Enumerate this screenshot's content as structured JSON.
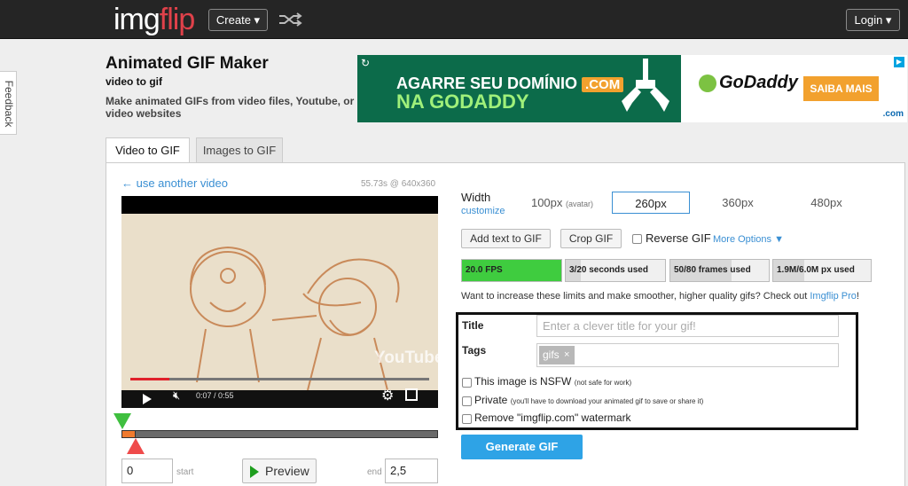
{
  "topbar": {
    "logo_part1": "img",
    "logo_part2": "flip",
    "create_label": "Create ▾",
    "login_label": "Login ▾"
  },
  "feedback": {
    "label": "Feedback"
  },
  "header": {
    "title": "Animated GIF Maker",
    "subtitle": "video to gif",
    "description": "Make animated GIFs from video files, Youtube, or video websites"
  },
  "ad": {
    "line1": "AGARRE SEU DOMÍNIO",
    "dotcom": ".COM",
    "line2": "NA GODADDY",
    "brand": "GoDaddy",
    "cta": "SAIBA MAIS",
    "badge": ".com",
    "adchoice": "▶",
    "refresh_icon": "↻"
  },
  "tabs": [
    {
      "label": "Video to GIF",
      "active": true
    },
    {
      "label": "Images to GIF",
      "active": false
    }
  ],
  "video": {
    "use_another": "← use another video",
    "meta": "55.73s @ 640x360",
    "time": "0:07 / 0:55",
    "watermark": "YouTube",
    "progress_fraction": 0.13
  },
  "timeline": {
    "start_value": "0",
    "start_label": "start",
    "preview_label": "Preview",
    "end_label": "end",
    "end_value": "2,5"
  },
  "width": {
    "label": "Width",
    "customize": "customize",
    "options": [
      {
        "label": "100px",
        "note": "(avatar)"
      },
      {
        "label": "260px",
        "selected": true
      },
      {
        "label": "360px"
      },
      {
        "label": "480px"
      }
    ]
  },
  "actions": {
    "add_text": "Add text to GIF",
    "crop": "Crop GIF",
    "reverse": "Reverse GIF",
    "more_options": "More Options ▼"
  },
  "meters": [
    {
      "text": "20.0 FPS",
      "fraction": 1.0,
      "color": "#3fcc3f"
    },
    {
      "text": "3/20 seconds used",
      "fraction": 0.15,
      "color": "#d8d8d8"
    },
    {
      "text": "50/80 frames used",
      "fraction": 0.625,
      "color": "#d8d8d8"
    },
    {
      "text": "1.9M/6.0M px used",
      "fraction": 0.32,
      "color": "#d8d8d8"
    }
  ],
  "upsell": {
    "text": "Want to increase these limits and make smoother, higher quality gifs? Check out ",
    "link": "Imgflip Pro",
    "tail": "!"
  },
  "options": {
    "title_label": "Title",
    "title_placeholder": "Enter a clever title for your gif!",
    "tags_label": "Tags",
    "tag": "gifs",
    "nsfw_label": "This image is NSFW",
    "nsfw_note": "(not safe for work)",
    "private_label": "Private",
    "private_note": "(you'll have to download your animated gif to save or share it)",
    "watermark_label": "Remove \"imgflip.com\" watermark"
  },
  "generate_label": "Generate GIF"
}
